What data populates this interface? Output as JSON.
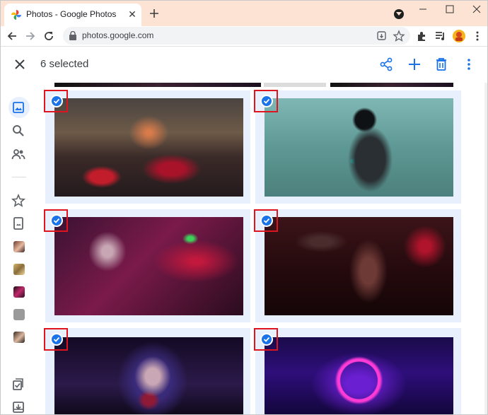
{
  "browser": {
    "tab_title": "Photos - Google Photos",
    "url": "photos.google.com"
  },
  "photos": {
    "selection_label": "6 selected",
    "actions": [
      "share-icon",
      "add-icon",
      "delete-icon",
      "more-vert-icon"
    ]
  },
  "sidebar": {
    "icons": [
      "photos-icon",
      "search-icon",
      "sharing-icon",
      "favorites-icon",
      "library-icon"
    ],
    "album_thumbnails": 5,
    "bottom_icons": [
      "utilities-icon",
      "archive-icon"
    ]
  },
  "grid": {
    "photos": [
      {
        "name": "cyberpunk-motorcycle-rider",
        "selected": true
      },
      {
        "name": "cyborg-back-matrix",
        "selected": true
      },
      {
        "name": "cyberpunk-girl-gun-neon",
        "selected": true
      },
      {
        "name": "cyberpunk-woman-pistol-red",
        "selected": true
      },
      {
        "name": "hooded-girl-mask",
        "selected": true
      },
      {
        "name": "neon-ring-tunnel",
        "selected": true
      }
    ]
  },
  "colors": {
    "selection_blue": "#1a73e8",
    "highlight_red": "#e0141e",
    "cell_tint": "#e8f0fe",
    "titlebar": "#fde3d3"
  }
}
